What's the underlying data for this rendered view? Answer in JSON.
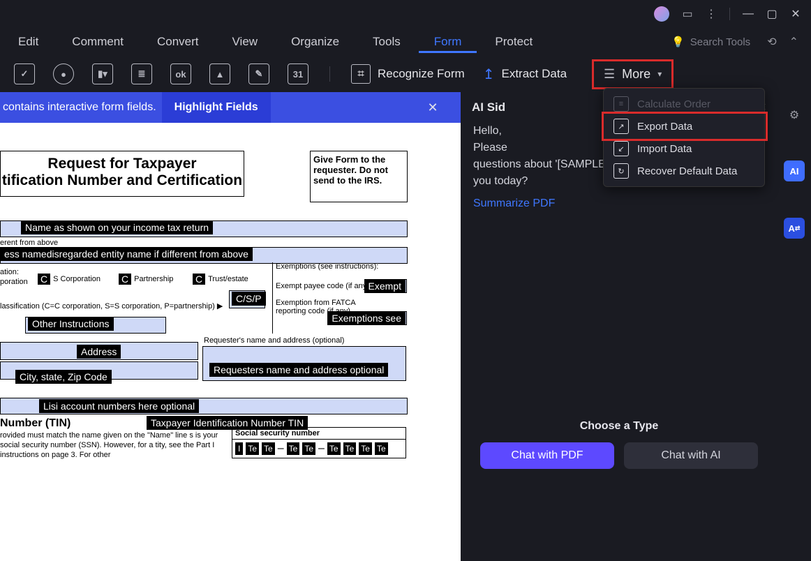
{
  "menubar": {
    "items": [
      "Edit",
      "Comment",
      "Convert",
      "View",
      "Organize",
      "Tools",
      "Form",
      "Protect"
    ],
    "active": "Form",
    "search_placeholder": "Search Tools"
  },
  "toolbar": {
    "icon_hints": [
      "ok",
      "31"
    ],
    "recognize": "Recognize Form",
    "extract": "Extract Data",
    "more": "More"
  },
  "dropdown": {
    "calc": "Calculate Order",
    "export": "Export Data",
    "import": "Import Data",
    "recover": "Recover Default Data"
  },
  "banner": {
    "msg": "contains interactive form fields.",
    "highlight": "Highlight Fields"
  },
  "doc": {
    "title_l1": "Request for Taxpayer",
    "title_l2": "tification Number and Certification",
    "giveform": "Give Form to the requester. Do not send to the IRS.",
    "name_label": "Name as shown on your income tax return",
    "diff": "erent from above",
    "entity": "ess namedisregarded entity name if different from above",
    "ation": "ation:",
    "poration": "poration",
    "c_scorp": "S Corporation",
    "c_partner": "Partnership",
    "c_trust": "Trust/estate",
    "csp": "C/S/P",
    "classif": "lassification (C=C corporation, S=S corporation, P=partnership) ▶",
    "other": "Other Instructions",
    "exempt_hdr": "Exemptions (see instructions):",
    "exempt_payee": "Exempt payee code (if any)",
    "exempt_lbl": "Exempt",
    "fatca": "Exemption from FATCA reporting code (if any)",
    "exemptions_see": "Exemptions see",
    "req_name": "Requester's name and address (optional)",
    "address": "Address",
    "city": "City, state, Zip Code",
    "req_black": "Requesters name and address optional",
    "lisi": "Lisi account numbers here optional",
    "tin_hdr": "Number (TIN)",
    "tin_black": "Taxpayer Identification Number TIN",
    "tin_body": "rovided must match the name given on the \"Name\" line s is your social security number (SSN). However, for a tity, see the Part I instructions on page 3. For other",
    "ssn": "Social security number",
    "te": "Te"
  },
  "ai": {
    "title": "AI Sid",
    "greeting": "Hello,",
    "line2": "Please",
    "line3": "questions about '[SAMPLE] W9-form.pdf'. How can I assist you today?",
    "summarize": "Summarize PDF",
    "choose": "Choose a Type",
    "chat_pdf": "Chat with PDF",
    "chat_ai": "Chat with AI"
  },
  "rail": {
    "ai": "AI",
    "at": "A"
  }
}
